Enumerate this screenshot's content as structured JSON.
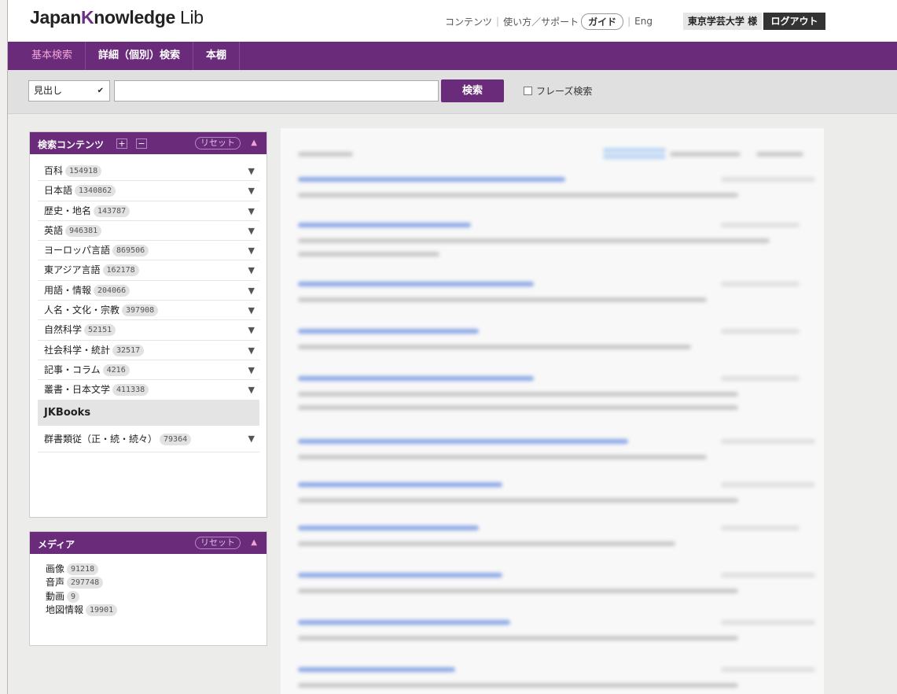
{
  "header": {
    "logo_pre": "Japan",
    "logo_k": "K",
    "logo_post": "nowledge",
    "logo_lib": "Lib",
    "links": [
      "コンテンツ",
      "使い方／サポート"
    ],
    "guide": "ガイド",
    "eng": "Eng",
    "org": "東京学芸大学 様",
    "logout": "ログアウト"
  },
  "nav": {
    "tabs": [
      "基本検索",
      "詳細（個別）検索",
      "本棚"
    ]
  },
  "search": {
    "field_select": "見出し",
    "query": "",
    "button": "検索",
    "phrase_label": "フレーズ検索"
  },
  "contents_panel": {
    "title": "検索コンテンツ",
    "reset": "リセット",
    "items": [
      {
        "label": "百科",
        "count": "154918"
      },
      {
        "label": "日本語",
        "count": "1340862"
      },
      {
        "label": "歴史・地名",
        "count": "143787"
      },
      {
        "label": "英語",
        "count": "946381"
      },
      {
        "label": "ヨーロッパ言語",
        "count": "869506"
      },
      {
        "label": "東アジア言語",
        "count": "162178"
      },
      {
        "label": "用語・情報",
        "count": "204066"
      },
      {
        "label": "人名・文化・宗教",
        "count": "397908"
      },
      {
        "label": "自然科学",
        "count": "52151"
      },
      {
        "label": "社会科学・統計",
        "count": "32517"
      },
      {
        "label": "記事・コラム",
        "count": "4216"
      },
      {
        "label": "叢書・日本文学",
        "count": "411338"
      }
    ],
    "jkbooks": "JKBooks",
    "jk_items": [
      {
        "label": "群書類従（正・続・続々）",
        "count": "79364"
      }
    ]
  },
  "media_panel": {
    "title": "メディア",
    "reset": "リセット",
    "items": [
      {
        "label": "画像",
        "count": "91218"
      },
      {
        "label": "音声",
        "count": "297748"
      },
      {
        "label": "動画",
        "count": "9"
      },
      {
        "label": "地図情報",
        "count": "19901"
      }
    ]
  },
  "colors": {
    "brand_purple": "#6a2b7b",
    "active_tab": "#f2a6d8"
  }
}
